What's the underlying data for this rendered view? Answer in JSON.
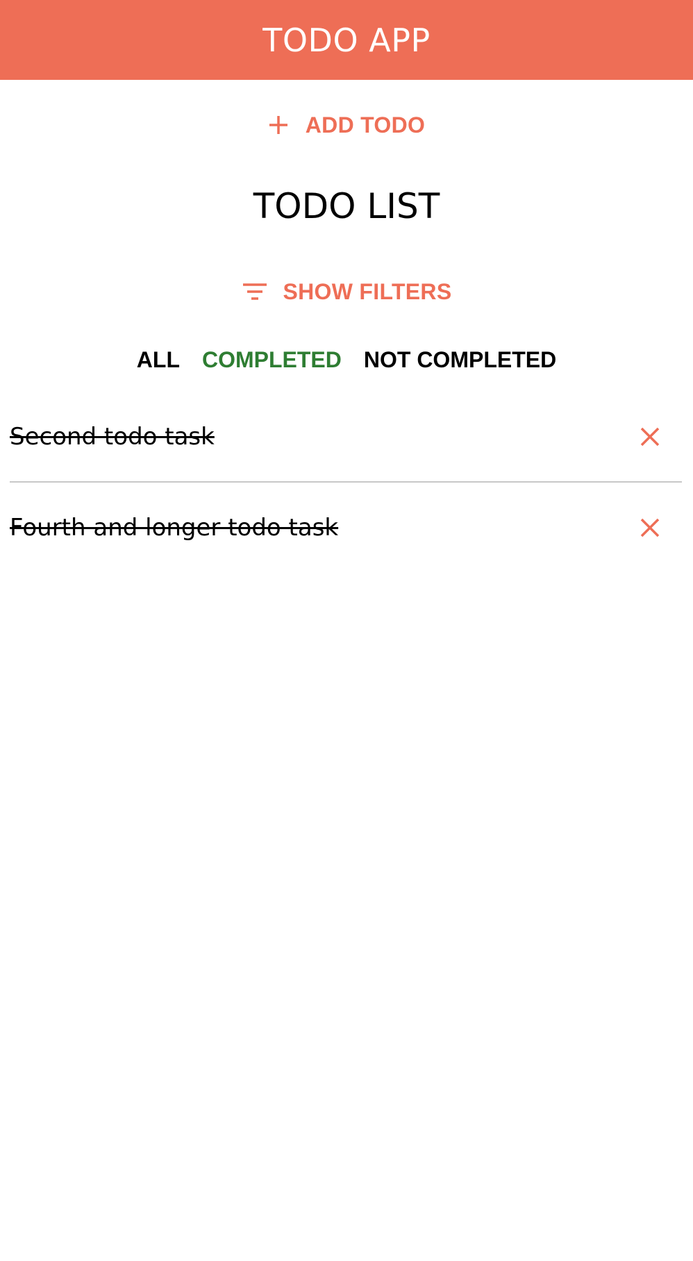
{
  "header": {
    "title": "TODO APP",
    "background_color": "#ee6e56"
  },
  "add_todo": {
    "label": "ADD TODO",
    "icon": "plus-icon",
    "color": "#ee6e56"
  },
  "list": {
    "title": "TODO LIST"
  },
  "show_filters": {
    "label": "SHOW FILTERS",
    "icon": "filter-icon",
    "color": "#ee6e56"
  },
  "filters": {
    "all": "ALL",
    "completed": "COMPLETED",
    "not_completed": "NOT COMPLETED",
    "active": "completed",
    "active_color": "#2e7d32"
  },
  "todos": [
    {
      "text": "Second todo task",
      "completed": true,
      "delete_icon": "close-icon"
    },
    {
      "text": "Fourth and longer todo task",
      "completed": true,
      "delete_icon": "close-icon"
    }
  ]
}
